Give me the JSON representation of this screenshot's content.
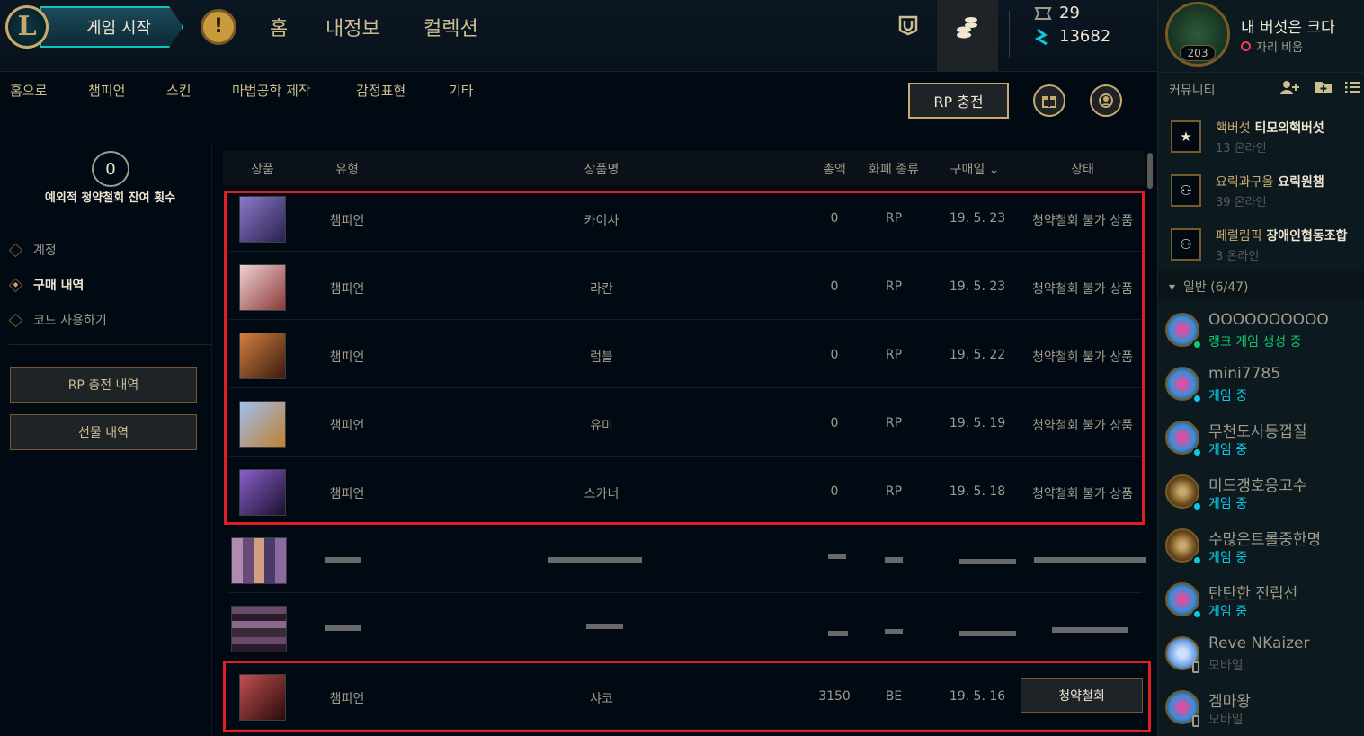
{
  "topbar": {
    "logo_letter": "L",
    "play_label": "게임 시작",
    "nav": [
      "홈",
      "내정보",
      "컬렉션"
    ],
    "currency": {
      "be": "29",
      "rp": "13682"
    }
  },
  "subnav": {
    "items": [
      "홈으로",
      "챔피언",
      "스킨",
      "마법공학 제작",
      "감정표현",
      "기타"
    ],
    "rp_charge_label": "RP 충전"
  },
  "left": {
    "refund_count": "0",
    "refund_label": "예외적 청약철회 잔여 횟수",
    "menu": [
      {
        "label": "계정",
        "active": false
      },
      {
        "label": "구매 내역",
        "active": true
      },
      {
        "label": "코드 사용하기",
        "active": false
      }
    ],
    "rp_history_label": "RP 충전 내역",
    "gift_history_label": "선물 내역"
  },
  "table": {
    "headers": [
      "상품",
      "유형",
      "상품명",
      "총액",
      "화폐 종류",
      "구매일",
      "상태"
    ],
    "rows": [
      {
        "type": "챔피언",
        "name": "카이사",
        "total": "0",
        "currency": "RP",
        "date": "19. 5. 23",
        "status": "청약철회 불가 상품",
        "thumb": "#5a4a8a"
      },
      {
        "type": "챔피언",
        "name": "라칸",
        "total": "0",
        "currency": "RP",
        "date": "19. 5. 23",
        "status": "청약철회 불가 상품",
        "thumb": "#c8a0a0"
      },
      {
        "type": "챔피언",
        "name": "럼블",
        "total": "0",
        "currency": "RP",
        "date": "19. 5. 22",
        "status": "청약철회 불가 상품",
        "thumb": "#b0602a"
      },
      {
        "type": "챔피언",
        "name": "유미",
        "total": "0",
        "currency": "RP",
        "date": "19. 5. 19",
        "status": "청약철회 불가 상품",
        "thumb": "#6a8ac8"
      },
      {
        "type": "챔피언",
        "name": "스카너",
        "total": "0",
        "currency": "RP",
        "date": "19. 5. 18",
        "status": "청약철회 불가 상품",
        "thumb": "#4a3a8a"
      }
    ],
    "last_row": {
      "type": "챔피언",
      "name": "샤코",
      "total": "3150",
      "currency": "BE",
      "date": "19. 5. 16",
      "refund_label": "청약철회",
      "thumb": "#8a3a3a"
    }
  },
  "social": {
    "summoner_name": "내 버섯은 크다",
    "summoner_status": "자리 비움",
    "level": "203",
    "community_label": "커뮤니티",
    "clubs": [
      {
        "tag": "핵버섯",
        "name": "티모의핵버섯",
        "online": "13 온라인",
        "icon": "★"
      },
      {
        "tag": "요릭과구울",
        "name": "요릭원챔",
        "online": "39 온라인",
        "icon": "⚇"
      },
      {
        "tag": "페럴림픽",
        "name": "장애인협동조합",
        "online": "3 온라인",
        "icon": "⚇"
      }
    ],
    "group_label": "일반 (6/47)",
    "friends": [
      {
        "name": "OOOOOOOOOO",
        "status": "랭크 게임 생성 중",
        "kind": "ranked",
        "avatar": "poro"
      },
      {
        "name": "mini7785",
        "status": "게임 중",
        "kind": "ingame",
        "avatar": "poro"
      },
      {
        "name": "무천도사등껍질",
        "status": "게임 중",
        "kind": "ingame",
        "avatar": "poro"
      },
      {
        "name": "미드갱호응고수",
        "status": "게임 중",
        "kind": "ingame",
        "avatar": "trophy"
      },
      {
        "name": "수많은트롤중한명",
        "status": "게임 중",
        "kind": "ingame",
        "avatar": "trophy"
      },
      {
        "name": "탄탄한 전립선",
        "status": "게임 중",
        "kind": "ingame",
        "avatar": "poro"
      },
      {
        "name": "Reve NKaizer",
        "status": "모바일",
        "kind": "mobile",
        "avatar": "blue"
      },
      {
        "name": "겜마왕",
        "status": "모바일",
        "kind": "mobile",
        "avatar": "poro"
      }
    ]
  }
}
